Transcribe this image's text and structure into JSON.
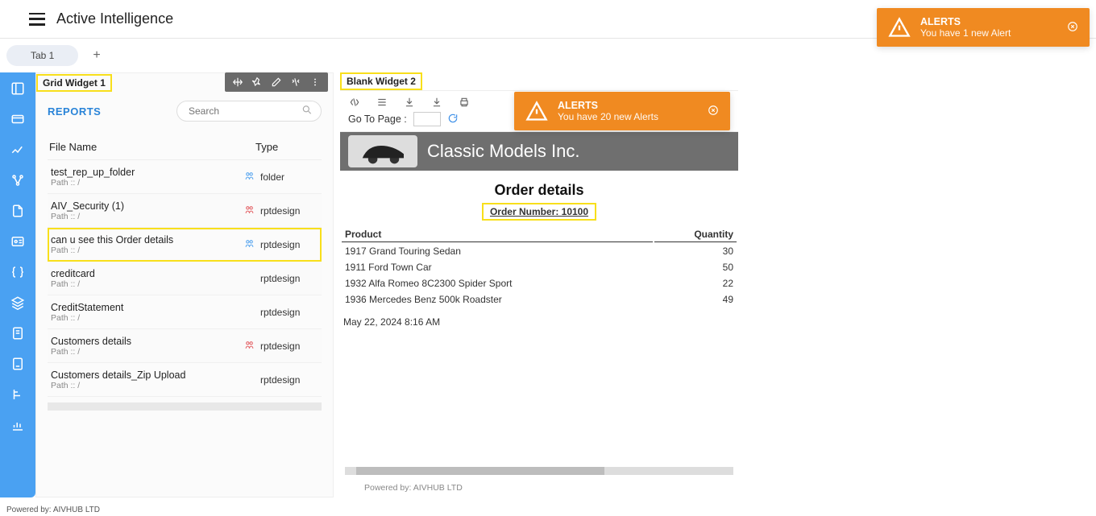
{
  "header": {
    "title": "Active Intelligence"
  },
  "tabs": {
    "items": [
      "Tab 1"
    ]
  },
  "widget1": {
    "title": "Grid Widget 1",
    "section": "REPORTS",
    "search_placeholder": "Search",
    "columns": {
      "file": "File Name",
      "type": "Type",
      "path_label": "Path :: /"
    },
    "rows": [
      {
        "name": "test_rep_up_folder",
        "path": "Path :: /",
        "shared": "blue",
        "type": "folder"
      },
      {
        "name": "AIV_Security (1)",
        "path": "Path :: /",
        "shared": "red",
        "type": "rptdesign"
      },
      {
        "name": "can u see this Order details",
        "path": "Path :: /",
        "shared": "blue",
        "type": "rptdesign",
        "highlight": true
      },
      {
        "name": "creditcard",
        "path": "Path :: /",
        "shared": "",
        "type": "rptdesign"
      },
      {
        "name": "CreditStatement",
        "path": "Path :: /",
        "shared": "",
        "type": "rptdesign"
      },
      {
        "name": "Customers details",
        "path": "Path :: /",
        "shared": "red",
        "type": "rptdesign"
      },
      {
        "name": "Customers details_Zip Upload",
        "path": "Path :: /",
        "shared": "",
        "type": "rptdesign"
      }
    ]
  },
  "widget2": {
    "title": "Blank Widget 2",
    "goto_label": "Go To Page :",
    "brand": "Classic Models Inc.",
    "order_title": "Order details",
    "order_number_label": "Order Number: 10100",
    "columns": {
      "product": "Product",
      "qty": "Quantity"
    },
    "lines": [
      {
        "product": "1917 Grand Touring Sedan",
        "qty": "30"
      },
      {
        "product": "1911 Ford Town Car",
        "qty": "50"
      },
      {
        "product": "1932 Alfa Romeo 8C2300 Spider Sport",
        "qty": "22"
      },
      {
        "product": "1936 Mercedes Benz 500k Roadster",
        "qty": "49"
      }
    ],
    "date": "May 22, 2024 8:16 AM",
    "powered": "Powered by: AIVHUB LTD"
  },
  "alerts": {
    "inner": {
      "title": "ALERTS",
      "body": "You have 20 new Alerts"
    },
    "global": {
      "title": "ALERTS",
      "body": "You have 1 new Alert"
    }
  },
  "footer": "Powered by: AIVHUB LTD"
}
